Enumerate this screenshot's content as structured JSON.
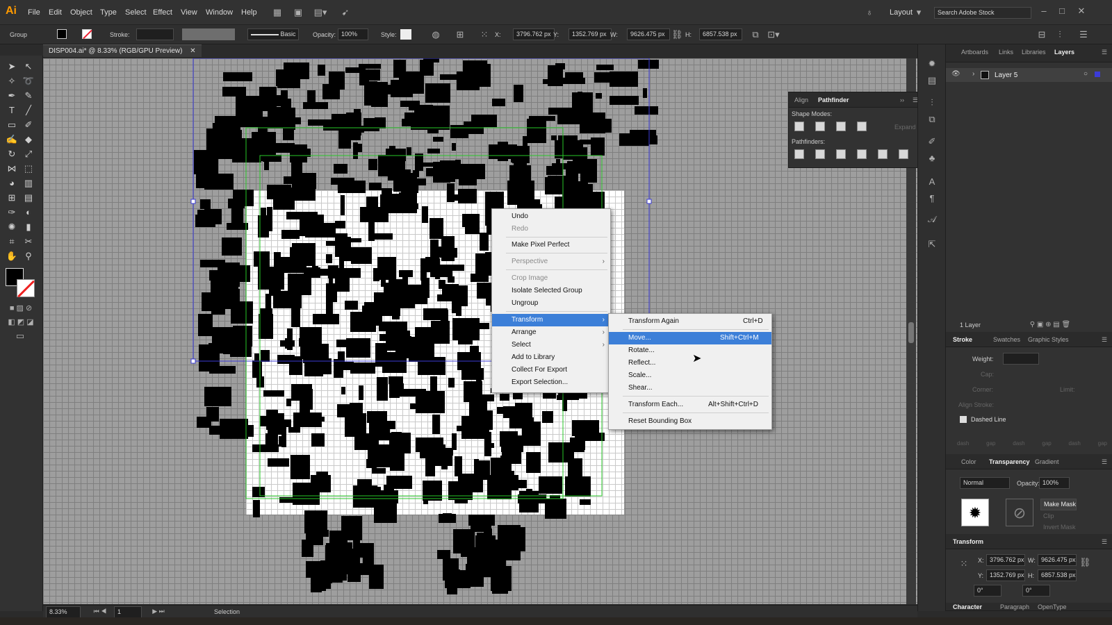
{
  "app": {
    "logo": "Ai",
    "menu": [
      "File",
      "Edit",
      "Object",
      "Type",
      "Select",
      "Effect",
      "View",
      "Window",
      "Help"
    ],
    "workspace": "Layout",
    "search_placeholder": "Search Adobe Stock"
  },
  "control": {
    "selection_kind": "Group",
    "stroke_label": "Stroke:",
    "brush": "Basic",
    "opacity_label": "Opacity:",
    "opacity": "100%",
    "style_label": "Style:",
    "x_label": "X:",
    "x": "3796.762 px",
    "y_label": "Y:",
    "y": "1352.769 px",
    "w_label": "W:",
    "w": "9626.475 px",
    "h_label": "H:",
    "h": "6857.538 px"
  },
  "document": {
    "tab_title": "DISP004.ai* @ 8.33% (RGB/GPU Preview)"
  },
  "status": {
    "zoom": "8.33%",
    "artboard": "1",
    "tool": "Selection"
  },
  "context_menu": {
    "items": [
      {
        "label": "Undo",
        "enabled": true
      },
      {
        "label": "Redo",
        "enabled": false
      },
      {
        "label": "Make Pixel Perfect",
        "enabled": true
      },
      {
        "label": "Perspective",
        "enabled": false,
        "submenu": true
      },
      {
        "label": "Crop Image",
        "enabled": false
      },
      {
        "label": "Isolate Selected Group",
        "enabled": true
      },
      {
        "label": "Ungroup",
        "enabled": true
      },
      {
        "label": "Transform",
        "enabled": true,
        "submenu": true,
        "highlighted": true
      },
      {
        "label": "Arrange",
        "enabled": true,
        "submenu": true
      },
      {
        "label": "Select",
        "enabled": true,
        "submenu": true
      },
      {
        "label": "Add to Library",
        "enabled": true
      },
      {
        "label": "Collect For Export",
        "enabled": true
      },
      {
        "label": "Export Selection...",
        "enabled": true
      }
    ]
  },
  "transform_submenu": {
    "items": [
      {
        "label": "Transform Again",
        "shortcut": "Ctrl+D"
      },
      {
        "label": "Move...",
        "shortcut": "Shift+Ctrl+M",
        "highlighted": true
      },
      {
        "label": "Rotate...",
        "shortcut": ""
      },
      {
        "label": "Reflect...",
        "shortcut": ""
      },
      {
        "label": "Scale...",
        "shortcut": ""
      },
      {
        "label": "Shear...",
        "shortcut": ""
      },
      {
        "label": "Transform Each...",
        "shortcut": "Alt+Shift+Ctrl+D"
      },
      {
        "label": "Reset Bounding Box",
        "shortcut": ""
      }
    ]
  },
  "pathfinder": {
    "tabs": [
      "Align",
      "Pathfinder"
    ],
    "shape_modes": "Shape Modes:",
    "expand": "Expand",
    "pathfinders": "Pathfinders:"
  },
  "right_panels": {
    "top_tabs": [
      "Artboards",
      "Links",
      "Libraries",
      "Layers"
    ],
    "layer_name": "Layer 5",
    "layer_count": "1 Layer",
    "stroke_tabs": [
      "Stroke",
      "Swatches",
      "Graphic Styles"
    ],
    "weight_label": "Weight:",
    "cap_label": "Cap:",
    "corner_label": "Corner:",
    "limit_label": "Limit:",
    "align_label": "Align Stroke:",
    "dashed_line": "Dashed Line",
    "dash_labels": [
      "dash",
      "gap",
      "dash",
      "gap",
      "dash",
      "gap"
    ],
    "color_tabs": [
      "Color",
      "Transparency",
      "Gradient"
    ],
    "blend": "Normal",
    "opacity_label": "Opacity:",
    "opacity": "100%",
    "make_mask": "Make Mask",
    "clip": "Clip",
    "invert_mask": "Invert Mask",
    "transform_title": "Transform",
    "tx_label": "X:",
    "tx": "3796.762 px",
    "ty_label": "Y:",
    "ty": "1352.769 px",
    "tw_label": "W:",
    "tw": "9626.475 px",
    "th_label": "H:",
    "th": "6857.538 px",
    "angle": "0°",
    "shear": "0°",
    "bottom_tabs": [
      "Character",
      "Paragraph",
      "OpenType"
    ]
  },
  "colors": {
    "accent": "#3c7fd8",
    "canvas": "#9e9e9e",
    "artboard": "#ffffff",
    "guide": "#29c829",
    "selection": "#3b3bd8"
  }
}
